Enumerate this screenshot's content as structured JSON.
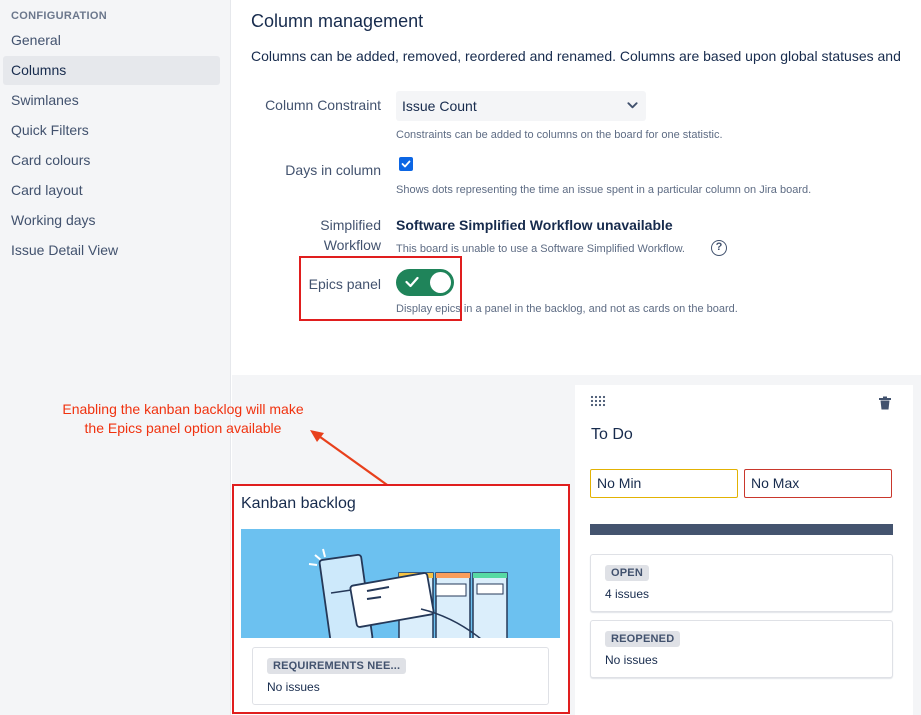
{
  "sidebar": {
    "heading": "CONFIGURATION",
    "items": [
      {
        "label": "General"
      },
      {
        "label": "Columns",
        "active": true
      },
      {
        "label": "Swimlanes"
      },
      {
        "label": "Quick Filters"
      },
      {
        "label": "Card colours"
      },
      {
        "label": "Card layout"
      },
      {
        "label": "Working days"
      },
      {
        "label": "Issue Detail View"
      }
    ]
  },
  "main": {
    "title": "Column management",
    "description": "Columns can be added, removed, reordered and renamed. Columns are based upon global statuses and",
    "column_constraint": {
      "label": "Column Constraint",
      "value": "Issue Count",
      "help": "Constraints can be added to columns on the board for one statistic."
    },
    "days_in_column": {
      "label": "Days in column",
      "checked": true,
      "help": "Shows dots representing the time an issue spent in a particular column on Jira board."
    },
    "simplified_workflow": {
      "label_line1": "Simplified",
      "label_line2": "Workflow",
      "title": "Software Simplified Workflow unavailable",
      "help": "This board is unable to use a Software Simplified Workflow.",
      "help_icon": "?"
    },
    "epics_panel": {
      "label": "Epics panel",
      "enabled": true,
      "help": "Display epics in a panel in the backlog, and not as cards on the board."
    }
  },
  "annotation": {
    "line1": "Enabling the kanban backlog will make",
    "line2": "the Epics panel option available",
    "color": "#f0320f"
  },
  "kanban_backlog": {
    "title": "Kanban backlog",
    "status": "REQUIREMENTS NEE...",
    "count": "No issues"
  },
  "todo_column": {
    "title": "To Do",
    "min_value": "No Min",
    "max_value": "No Max",
    "statuses": [
      {
        "name": "OPEN",
        "count": "4 issues"
      },
      {
        "name": "REOPENED",
        "count": "No issues"
      }
    ]
  },
  "colors": {
    "toggle_on": "#1f845a",
    "checkbox": "#0c66e4",
    "highlight_box": "#e01e1e",
    "illustration_bg": "#6cc1f0"
  }
}
